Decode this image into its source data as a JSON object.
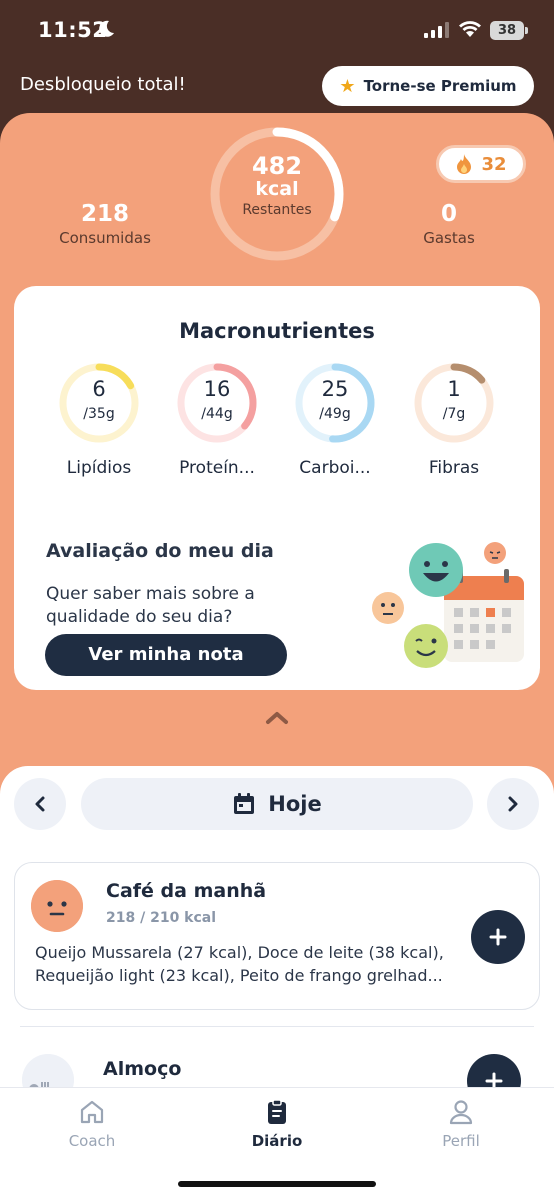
{
  "status_bar": {
    "time": "11:52",
    "battery": "38"
  },
  "banner": {
    "unlock_text": "Desbloqueio total!",
    "premium_label": "Torne-se Premium"
  },
  "summary": {
    "consumed": {
      "value": "218",
      "label": "Consumidas"
    },
    "remaining": {
      "value": "482",
      "unit": "kcal",
      "label": "Restantes"
    },
    "burned": {
      "value": "0",
      "label": "Gastas"
    },
    "streak": "32",
    "progress_fraction": 0.31
  },
  "macros": {
    "title": "Macronutrientes",
    "items": [
      {
        "value": "6",
        "goal": "/35g",
        "label": "Lipídios",
        "color": "#f7dd5a",
        "track": "#fdf3cf",
        "fraction": 0.17
      },
      {
        "value": "16",
        "goal": "/44g",
        "label": "Proteín...",
        "color": "#f4a0a0",
        "track": "#fde3e3",
        "fraction": 0.36
      },
      {
        "value": "25",
        "goal": "/49g",
        "label": "Carboi...",
        "color": "#a9d8f3",
        "track": "#e2f2fb",
        "fraction": 0.51
      },
      {
        "value": "1",
        "goal": "/7g",
        "label": "Fibras",
        "color": "#b58e6e",
        "track": "#fbe8da",
        "fraction": 0.14
      }
    ]
  },
  "evaluation": {
    "title": "Avaliação do meu dia",
    "text": "Quer saber mais sobre a qualidade do seu dia?",
    "button": "Ver minha nota"
  },
  "day": {
    "label": "Hoje"
  },
  "meals": [
    {
      "name": "Café da manhã",
      "kcal": "218 / 210 kcal",
      "foods": "Queijo Mussarela (27 kcal), Doce de leite (38 kcal), Requeijão light (23 kcal), Peito de frango grelhad..."
    },
    {
      "name": "Almoço"
    }
  ],
  "tabs": [
    {
      "label": "Coach",
      "icon": "home-icon"
    },
    {
      "label": "Diário",
      "icon": "diary-icon"
    },
    {
      "label": "Perfil",
      "icon": "profile-icon"
    }
  ]
}
